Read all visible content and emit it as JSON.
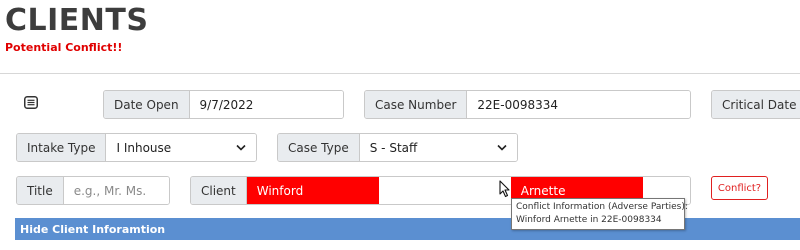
{
  "page": {
    "title": "CLIENTS",
    "alert": "Potential Conflict!!"
  },
  "menu": {
    "icon": "list-icon"
  },
  "fields": {
    "date_open": {
      "label": "Date Open",
      "value": "9/7/2022"
    },
    "case_number": {
      "label": "Case Number",
      "value": "22E-0098334"
    },
    "critical_date": {
      "label": "Critical Date"
    },
    "intake_type": {
      "label": "Intake Type",
      "value": "I Inhouse"
    },
    "case_type": {
      "label": "Case Type",
      "value": "S - Staff"
    },
    "title": {
      "label": "Title",
      "placeholder": "e.g., Mr. Ms."
    },
    "client": {
      "label": "Client",
      "first_name": "Winford",
      "last_name": "Arnette"
    }
  },
  "conflict_button": {
    "label": "Conflict?"
  },
  "hide_client_bar": {
    "label": "Hide Client Inforamtion"
  },
  "tooltip": {
    "line1": "Conflict Information (Adverse Parties):",
    "line2": "Winford Arnette in 22E-0098334"
  },
  "colors": {
    "alert": "#e00000",
    "conflict_highlight": "#ff0000",
    "bar": "#5b8fd1"
  }
}
